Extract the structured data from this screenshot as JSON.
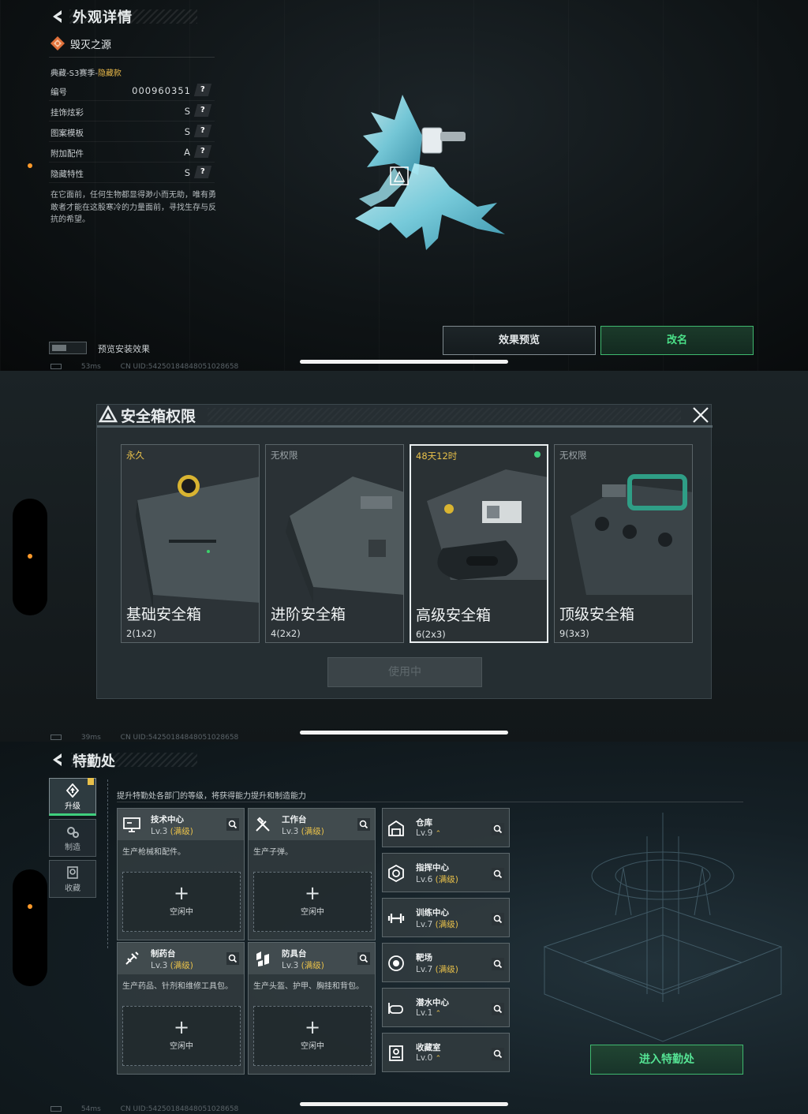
{
  "panel1": {
    "title": "外观详情",
    "item_name": "毁灭之源",
    "series": "典藏-S3赛季-",
    "series_tag": "隐藏款",
    "attributes": [
      {
        "label": "编号",
        "value": "000960351"
      },
      {
        "label": "挂饰炫彩",
        "value": "S"
      },
      {
        "label": "图案模板",
        "value": "S"
      },
      {
        "label": "附加配件",
        "value": "A"
      },
      {
        "label": "隐藏特性",
        "value": "S"
      }
    ],
    "help_symbol": "?",
    "description": "在它面前，任何生物都显得渺小而无助，唯有勇敢者才能在这股寒冷的力量面前，寻找生存与反抗的希望。",
    "preview_toggle_label": "预览安装效果",
    "preview_button": "效果预览",
    "rename_button": "改名",
    "status": {
      "ping": "53ms",
      "uid": "CN UID:542501848480510286​58"
    }
  },
  "panel2": {
    "title": "安全箱权限",
    "cases": [
      {
        "state": "永久",
        "name": "基础安全箱",
        "size": "2(1x2)"
      },
      {
        "state": "无权限",
        "name": "进阶安全箱",
        "size": "4(2x2)"
      },
      {
        "state": "48天12时",
        "name": "高级安全箱",
        "size": "6(2x3)"
      },
      {
        "state": "无权限",
        "name": "顶级安全箱",
        "size": "9(3x3)"
      }
    ],
    "use_button": "使用中",
    "status": {
      "ping": "39ms",
      "uid": "CN UID:54250184848051028658"
    }
  },
  "panel3": {
    "title": "特勤处",
    "subtitle": "提升特勤处各部门的等级，将获得能力提升和制造能力",
    "tabs": [
      "升级",
      "制造",
      "收藏"
    ],
    "departments": [
      {
        "name": "技术中心",
        "level": "Lv.3",
        "tag": "(满级)",
        "desc": "生产枪械和配件。",
        "slot": "空闲中"
      },
      {
        "name": "工作台",
        "level": "Lv.3",
        "tag": "(满级)",
        "desc": "生产子弹。",
        "slot": "空闲中"
      },
      {
        "name": "制药台",
        "level": "Lv.3",
        "tag": "(满级)",
        "desc": "生产药品、针剂和维修工具包。",
        "slot": "空闲中"
      },
      {
        "name": "防具台",
        "level": "Lv.3",
        "tag": "(满级)",
        "desc": "生产头盔、护甲、胸挂和背包。",
        "slot": "空闲中"
      }
    ],
    "facilities": [
      {
        "name": "仓库",
        "level": "Lv.9",
        "tag": ""
      },
      {
        "name": "指挥中心",
        "level": "Lv.6",
        "tag": "(满级)"
      },
      {
        "name": "训练中心",
        "level": "Lv.7",
        "tag": "(满级)"
      },
      {
        "name": "靶场",
        "level": "Lv.7",
        "tag": "(满级)"
      },
      {
        "name": "潜水中心",
        "level": "Lv.1",
        "tag": ""
      },
      {
        "name": "收藏室",
        "level": "Lv.0",
        "tag": ""
      }
    ],
    "plus_symbol": "+",
    "enter_button": "进入特勤处",
    "status": {
      "ping": "54ms",
      "uid": "CN UID:54250184848051028658"
    }
  },
  "colors": {
    "accent_green": "#3fcf7d",
    "gold": "#e8c04a",
    "orange_dot": "#ff9a2a"
  },
  "icons": [
    "back-arrow-icon",
    "diamond-badge-icon",
    "help-icon",
    "close-icon",
    "magnifier-icon",
    "plus-icon",
    "warning-triangle-icon"
  ]
}
